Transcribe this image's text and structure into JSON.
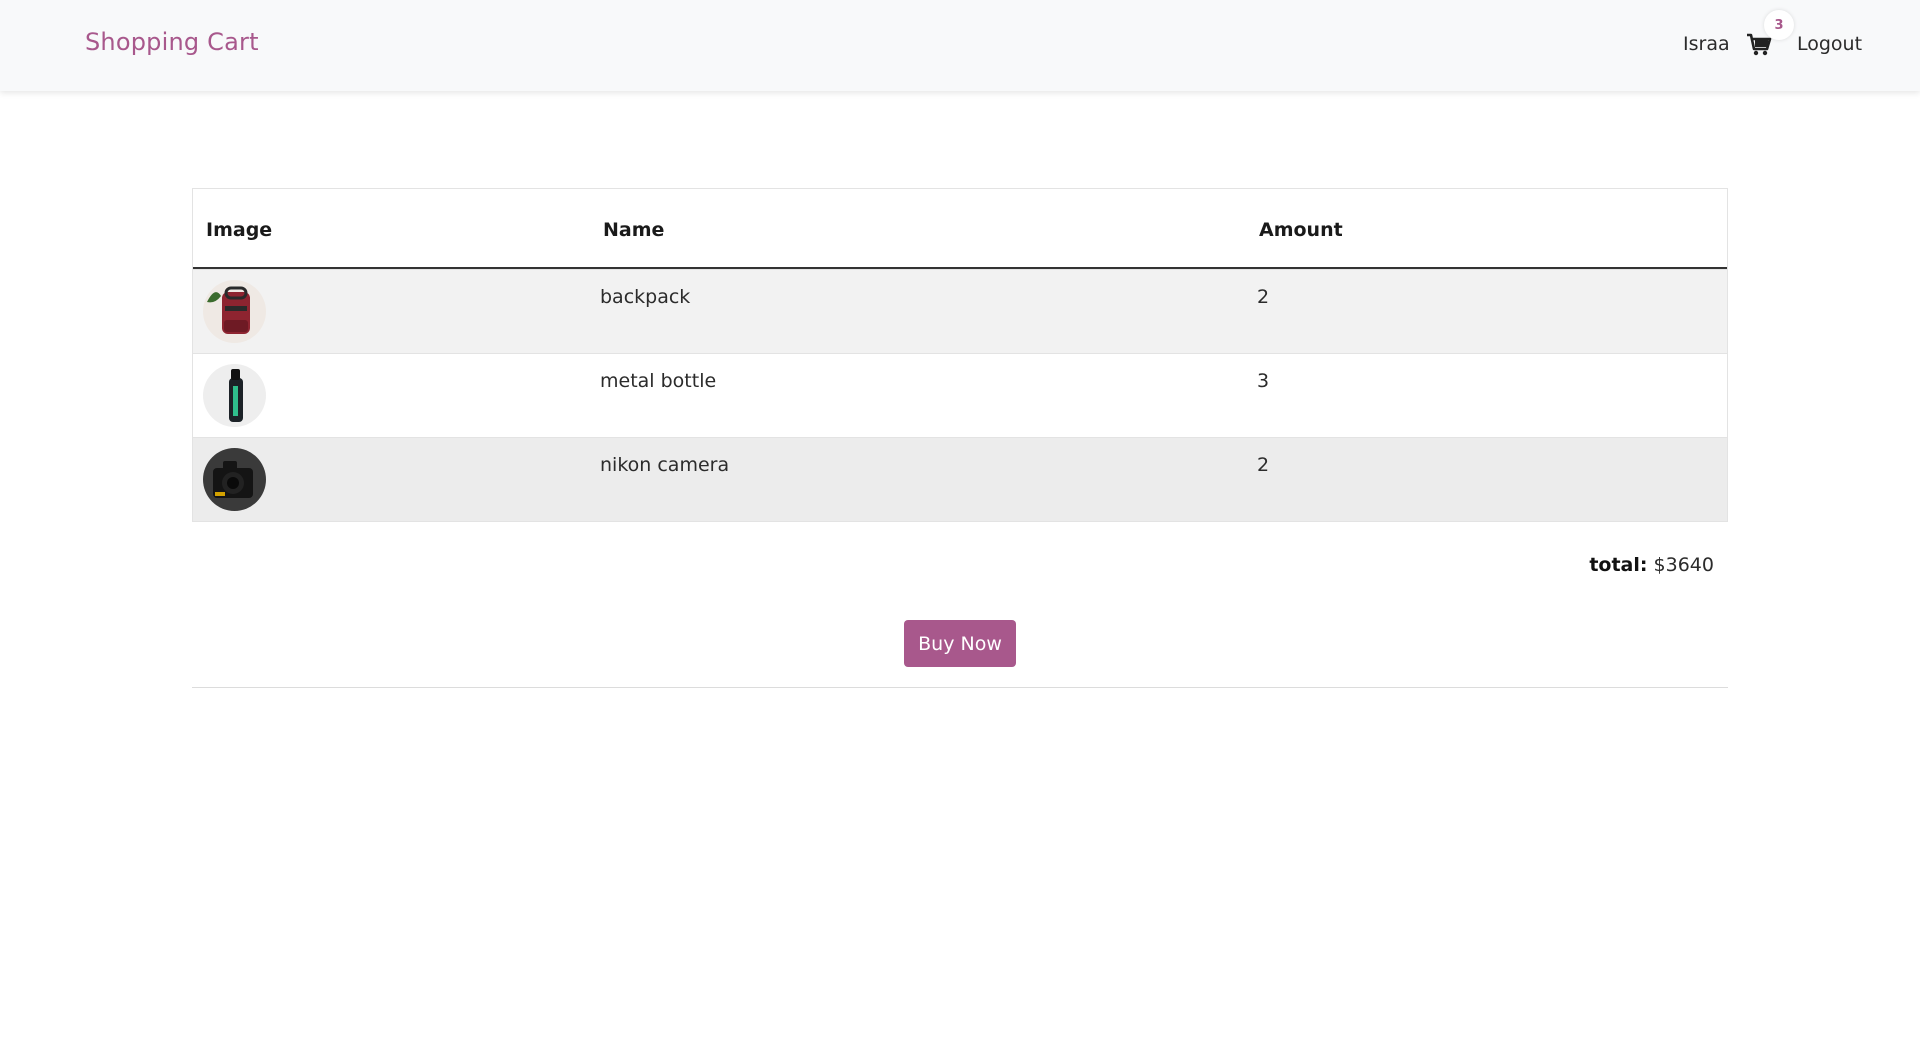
{
  "nav": {
    "brand": "Shopping Cart",
    "user": "Israa",
    "cart_count": "3",
    "logout": "Logout"
  },
  "table": {
    "headers": [
      "Image",
      "Name",
      "Amount"
    ],
    "rows": [
      {
        "image": "backpack-image",
        "name": "backpack",
        "amount": "2"
      },
      {
        "image": "metal-bottle-image",
        "name": "metal bottle",
        "amount": "3"
      },
      {
        "image": "nikon-camera-image",
        "name": "nikon camera",
        "amount": "2"
      }
    ]
  },
  "total": {
    "label": "total:",
    "value": "$3640"
  },
  "buy_button": "Buy Now",
  "colors": {
    "accent": "#a8588c",
    "navbar_bg": "#f8f9fa"
  }
}
